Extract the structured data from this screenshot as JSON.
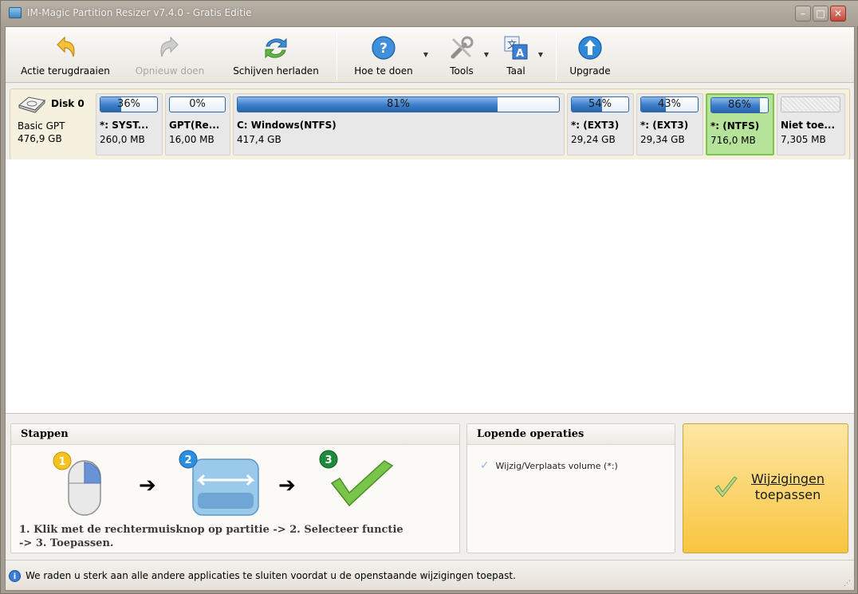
{
  "window": {
    "title": "IM-Magic Partition Resizer v7.4.0 - Gratis Editie",
    "min_glyph": "–",
    "max_glyph": "□",
    "close_glyph": "✕"
  },
  "toolbar": {
    "undo_label": "Actie terugdraaien",
    "redo_label": "Opnieuw doen",
    "reload_label": "Schijven herladen",
    "howto_label": "Hoe te doen",
    "tools_label": "Tools",
    "language_label": "Taal",
    "upgrade_label": "Upgrade",
    "caret": "▼"
  },
  "disk": {
    "name": "Disk 0",
    "type": "Basic GPT",
    "size": "476,9 GB",
    "partitions": [
      {
        "pct": "36%",
        "used": 0.36,
        "label": "*: SYST...",
        "size": "260,0 MB"
      },
      {
        "pct": "0%",
        "used": 0.0,
        "label": "GPT(Re...",
        "size": "16,00 MB"
      },
      {
        "pct": "81%",
        "used": 0.81,
        "label": "C: Windows(NTFS)",
        "size": "417,4 GB"
      },
      {
        "pct": "54%",
        "used": 0.54,
        "label": "*: (EXT3)",
        "size": "29,24 GB"
      },
      {
        "pct": "43%",
        "used": 0.43,
        "label": "*: (EXT3)",
        "size": "29,34 GB"
      },
      {
        "pct": "86%",
        "used": 0.86,
        "label": "*: (NTFS)",
        "size": "716,0 MB"
      },
      {
        "pct": "",
        "used": 0.0,
        "label": "Niet toe...",
        "size": "7,305 MB"
      }
    ]
  },
  "steps": {
    "title": "Stappen",
    "badge1": "1",
    "badge2": "2",
    "badge3": "3",
    "arrow": "➔",
    "text_line1": "1. Klik met de rechtermuisknop op partitie -> 2. Selecteer functie",
    "text_line2": "-> 3. Toepassen."
  },
  "operations": {
    "title": "Lopende operaties",
    "check_glyph": "✓",
    "items": [
      "Wijzig/Verplaats volume (*:)"
    ]
  },
  "apply": {
    "line1": "Wijzigingen",
    "line2": "toepassen"
  },
  "status": {
    "info_glyph": "i",
    "message": "We raden u sterk aan alle andere applicaties te sluiten voordat u de openstaande wijzigingen toepast.",
    "grip": "⋰"
  }
}
